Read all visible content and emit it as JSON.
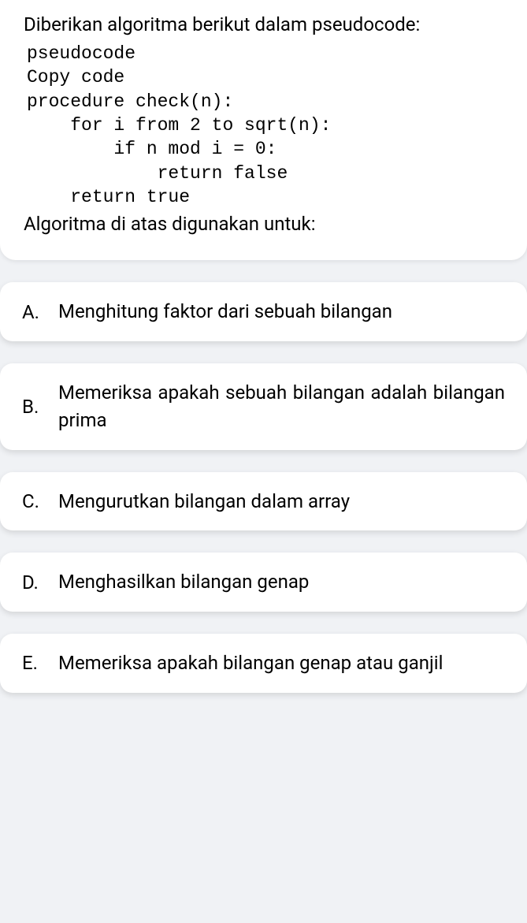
{
  "question": {
    "intro": "Diberikan algoritma berikut dalam pseudocode:",
    "code": "pseudocode\nCopy code\nprocedure check(n):\n    for i from 2 to sqrt(n):\n        if n mod i = 0:\n            return false\n    return true",
    "tail": "Algoritma di atas digunakan untuk:"
  },
  "options": [
    {
      "letter": "A.",
      "text": "Menghitung faktor dari sebuah bilangan",
      "justify": true
    },
    {
      "letter": "B.",
      "text": "Memeriksa apakah sebuah bilangan adalah bilangan prima",
      "justify": true
    },
    {
      "letter": "C.",
      "text": "Mengurutkan bilangan dalam array",
      "justify": false
    },
    {
      "letter": "D.",
      "text": "Menghasilkan bilangan genap",
      "justify": false
    },
    {
      "letter": "E.",
      "text": "Memeriksa apakah bilangan genap atau ganjil",
      "justify": true
    }
  ]
}
